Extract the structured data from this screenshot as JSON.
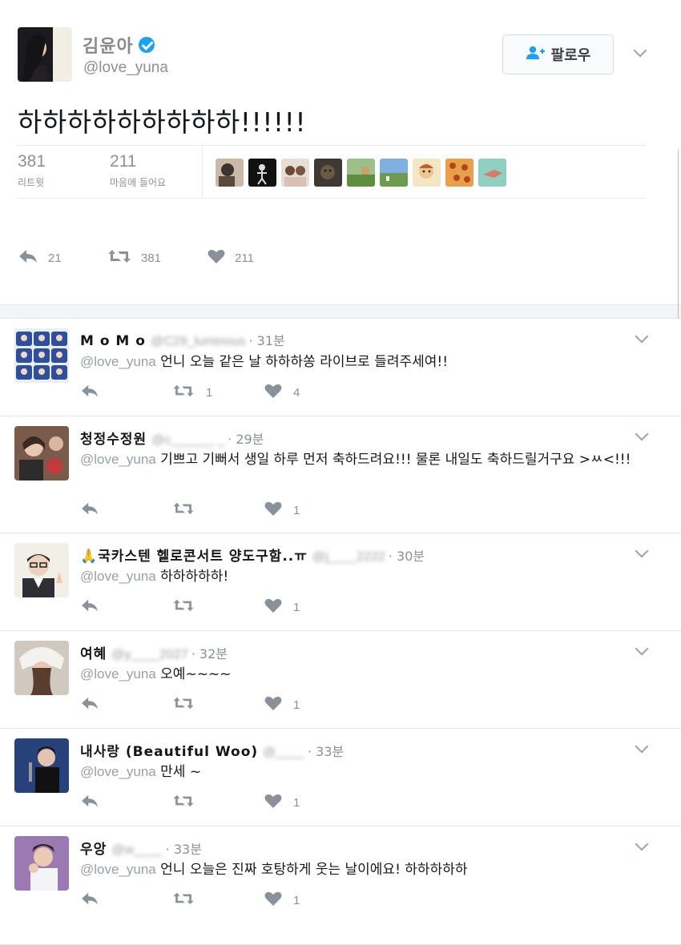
{
  "main_tweet": {
    "display_name": "김윤아",
    "handle": "@love_yuna",
    "follow_label": "팔로우",
    "text": "하하하하하하하하하!!!!!!",
    "retweets_count": "381",
    "retweets_label": "리트윗",
    "likes_count": "211",
    "likes_label": "마음에 들어요",
    "actions": {
      "reply_count": "21",
      "retweet_count": "381",
      "like_count": "211"
    }
  },
  "replies": [
    {
      "name": "M o M o",
      "handle": "@C29_luminous",
      "time": "· 31분",
      "mention": "@love_yuna",
      "text": "언니 오늘 같은 날 하하하쏭 라이브로 들려주세여!!",
      "retweet_count": "1",
      "like_count": "4"
    },
    {
      "name": "청정수정원",
      "handle": "@c______ _",
      "time": "· 29분",
      "mention": "@love_yuna",
      "text": "기쁘고 기뻐서 생일 하루 먼저 축하드려요!!! 물론 내일도 축하드릴거구요 >ㅆ<!!!",
      "retweet_count": "",
      "like_count": "1"
    },
    {
      "name": "🙏국카스텐 헬로콘서트 양도구함..ㅠ",
      "handle": "@j____2222",
      "time": "· 30분",
      "mention": "@love_yuna",
      "text": "하하하하하!",
      "retweet_count": "",
      "like_count": "1"
    },
    {
      "name": "여혜",
      "handle": "@y____2027",
      "time": "· 32분",
      "mention": "@love_yuna",
      "text": "오예~~~~",
      "retweet_count": "",
      "like_count": "1"
    },
    {
      "name": "내사랑 (Beautiful Woo)",
      "handle": "@____",
      "time": "· 33분",
      "mention": "@love_yuna",
      "text": "만세 ~",
      "retweet_count": "",
      "like_count": "1"
    },
    {
      "name": "우앙",
      "handle": "@w____",
      "time": "· 33분",
      "mention": "@love_yuna",
      "text": "언니 오늘은 진짜 호탕하게 웃는 날이에요! 하하하하하",
      "retweet_count": "",
      "like_count": "1"
    }
  ],
  "colors": {
    "accent": "#1da1f2",
    "icon_grey": "#8a9199",
    "divider": "#e1e8ed"
  },
  "icons": [
    "verified-icon",
    "follow-person-icon",
    "chevron-down-icon",
    "reply-icon",
    "retweet-icon",
    "heart-icon"
  ]
}
